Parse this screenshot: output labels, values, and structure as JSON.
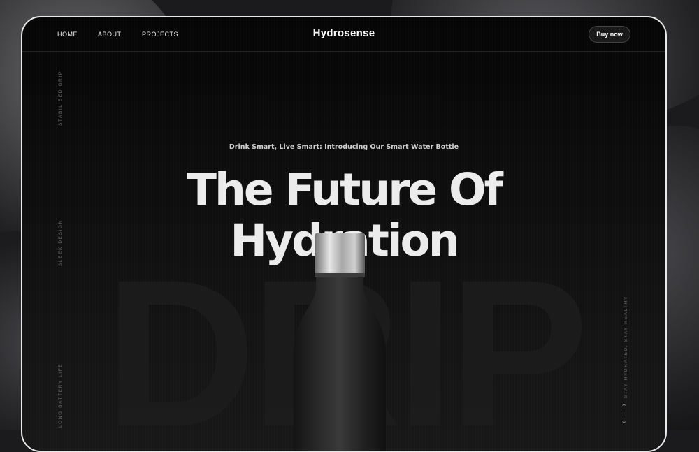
{
  "nav": {
    "links": [
      "HOME",
      "ABOUT",
      "PROJECTS"
    ],
    "brand": "Hydrosense",
    "cta": "Buy now"
  },
  "hero": {
    "subtitle": "Drink Smart, Live Smart: Introducing Our Smart Water Bottle",
    "headline_line1": "The Future Of",
    "headline_line2": "Hydration",
    "watermark": "DRIP"
  },
  "side_left": [
    "STABILISED GRIP",
    "SLEEK DESIGN",
    "LONG BATTERY LIFE"
  ],
  "side_right": "STAY HYDRATED, STAY HEALTHY",
  "colors": {
    "accent": "#ffffff",
    "background": "#0b0b0b"
  },
  "icons": [
    "arrow-up-icon",
    "arrow-down-icon"
  ]
}
